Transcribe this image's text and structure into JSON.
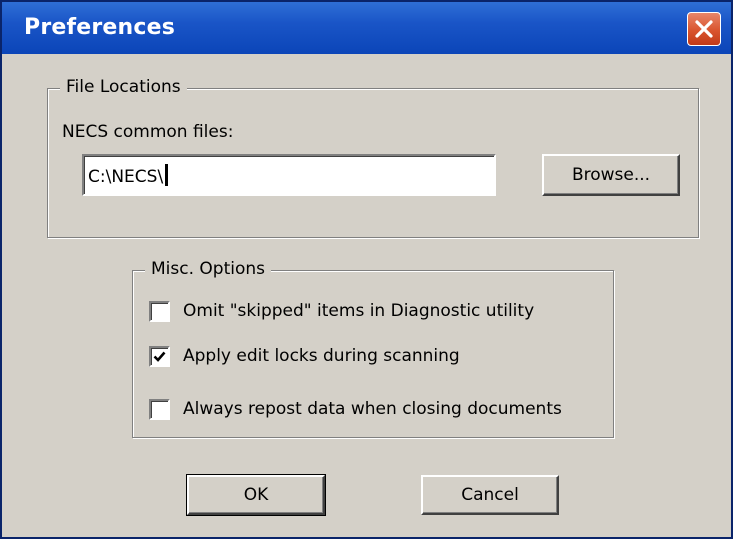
{
  "window": {
    "title": "Preferences"
  },
  "file_locations": {
    "group_label": "File Locations",
    "field_label": "NECS common files:",
    "path_value": "C:\\NECS\\",
    "browse_label": "Browse..."
  },
  "misc_options": {
    "group_label": "Misc. Options",
    "items": [
      {
        "label": "Omit \"skipped\" items in Diagnostic utility",
        "checked": false
      },
      {
        "label": "Apply edit locks during scanning",
        "checked": true
      },
      {
        "label": "Always repost data when closing documents",
        "checked": false
      }
    ]
  },
  "buttons": {
    "ok": "OK",
    "cancel": "Cancel"
  },
  "colors": {
    "titlebar": "#0b45b8",
    "close": "#d9542e",
    "face": "#d4d0c8"
  },
  "icons": {
    "close": "close-x-icon",
    "checkmark": "checkmark-icon"
  }
}
